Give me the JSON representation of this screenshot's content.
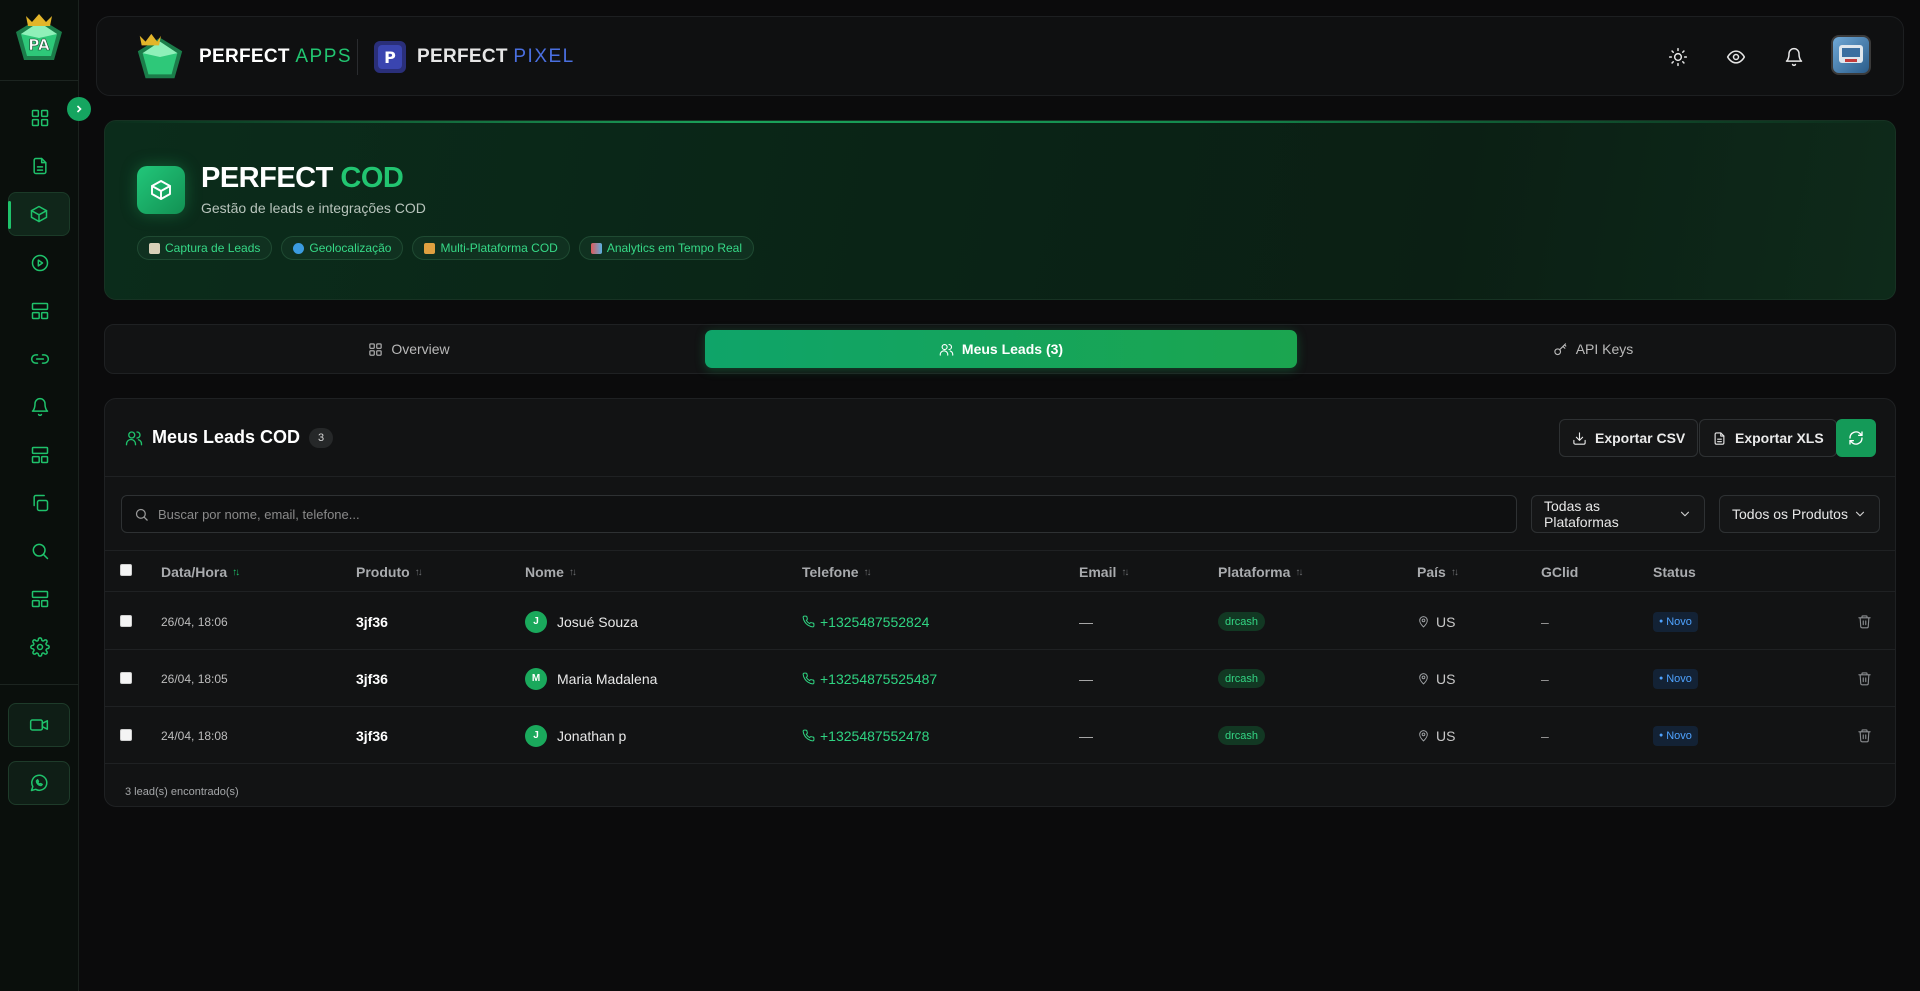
{
  "sidebar": {
    "items": [
      "dashboard-icon",
      "document-icon",
      "package-icon",
      "play-icon",
      "layout-icon",
      "link-icon",
      "bell-icon",
      "layout-icon",
      "copy-icon",
      "search-icon",
      "layout-icon",
      "gear-icon"
    ],
    "bottom": [
      "video-icon",
      "whatsapp-icon"
    ]
  },
  "header": {
    "brand1_a": "PERFECT",
    "brand1_b": "APPS",
    "brand2_a": "PERFECT",
    "brand2_b": "PIXEL"
  },
  "hero": {
    "title_a": "PERFECT",
    "title_b": "COD",
    "subtitle": "Gestão de leads e integrações COD",
    "chips": [
      "Captura de Leads",
      "Geolocalização",
      "Multi-Plataforma COD",
      "Analytics em Tempo Real"
    ]
  },
  "tabs": [
    "Overview",
    "Meus Leads (3)",
    "API Keys"
  ],
  "panel": {
    "title": "Meus Leads COD",
    "count": "3",
    "export_csv": "Exportar CSV",
    "export_xls": "Exportar XLS",
    "search_placeholder": "Buscar por nome, email, telefone...",
    "filter_platform": "Todas as Plataformas",
    "filter_product": "Todos os Produtos",
    "footer": "3 lead(s) encontrado(s)"
  },
  "table": {
    "headers": [
      "Data/Hora",
      "Produto",
      "Nome",
      "Telefone",
      "Email",
      "Plataforma",
      "País",
      "GClid",
      "Status"
    ],
    "rows": [
      {
        "date": "26/04, 18:06",
        "product": "3jf36",
        "initial": "J",
        "name": "Josué Souza",
        "phone": "+1325487552824",
        "email": "—",
        "platform": "drcash",
        "country": "US",
        "gclid": "–",
        "status": "Novo"
      },
      {
        "date": "26/04, 18:05",
        "product": "3jf36",
        "initial": "M",
        "name": "Maria Madalena",
        "phone": "+13254875525487",
        "email": "—",
        "platform": "drcash",
        "country": "US",
        "gclid": "–",
        "status": "Novo"
      },
      {
        "date": "24/04, 18:08",
        "product": "3jf36",
        "initial": "J",
        "name": "Jonathan p",
        "phone": "+1325487552478",
        "email": "—",
        "platform": "drcash",
        "country": "US",
        "gclid": "–",
        "status": "Novo"
      }
    ]
  },
  "colors": {
    "accent": "#1fc26b",
    "background": "#0b0b0c",
    "status_blue": "#4fa3ff"
  }
}
